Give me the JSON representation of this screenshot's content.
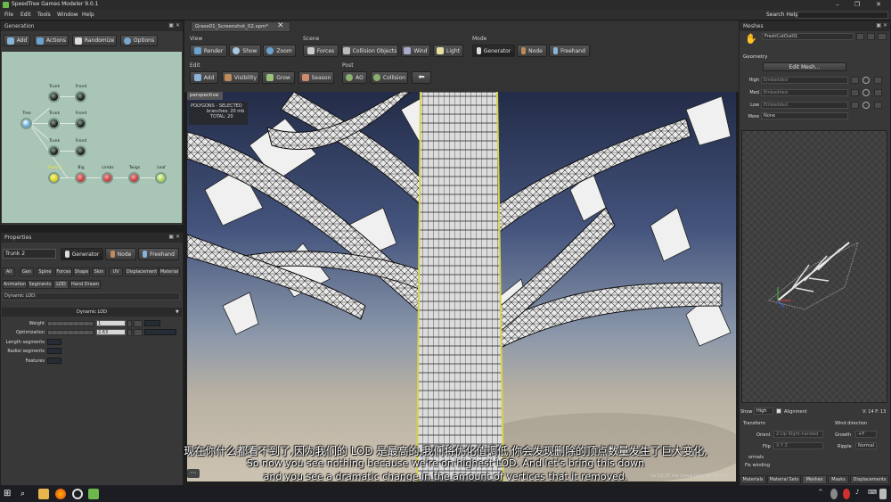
{
  "app": {
    "title": "SpeedTree Games Modeler 9.0.1"
  },
  "menu": [
    "File",
    "Edit",
    "Tools",
    "Window",
    "Help"
  ],
  "search_help": {
    "label": "Search Help:",
    "value": ""
  },
  "generation": {
    "title": "Generation",
    "toolbar": [
      "Add",
      "Actions",
      "Randomize",
      "Options"
    ],
    "nodes": {
      "root": "Tree",
      "trunk1": "Trunk",
      "frond1": "Frond",
      "trunk2": "Trunk",
      "frond2": "Frond",
      "trunk3": "Trunk",
      "frond3": "Frond",
      "trunk4": "Trunk 2",
      "big": "Big",
      "limbs": "Limbs",
      "twigs": "Twigs",
      "leaf": "Leaf"
    }
  },
  "properties": {
    "title": "Properties",
    "selected": "Trunk 2",
    "modes": [
      "Generator",
      "Node",
      "Freehand"
    ],
    "tabs_row1": [
      "All",
      "Gen",
      "Spine",
      "Forces",
      "Shape",
      "Skin",
      "UV",
      "Displacement",
      "Material"
    ],
    "tabs_row2": [
      "Animation",
      "Segments",
      "LOD",
      "Hand Drawn"
    ],
    "section": "Dynamic LOD:",
    "group": "Dynamic LOD",
    "rows": [
      {
        "label": "Weight",
        "value": "1"
      },
      {
        "label": "Optimization",
        "value": "2.63"
      },
      {
        "label": "Length segments",
        "value": ""
      },
      {
        "label": "Radial segments",
        "value": ""
      },
      {
        "label": "Features",
        "value": ""
      }
    ]
  },
  "document": {
    "tab": "Grass01_Screenshot_02.spm*"
  },
  "toolbar": {
    "view_label": "View",
    "view": [
      "Render",
      "Show",
      "Zoom"
    ],
    "scene_label": "Scene",
    "scene": [
      "Forces",
      "Collision Objects",
      "Wind",
      "Light"
    ],
    "mode_label": "Mode",
    "mode": [
      "Generator",
      "Node",
      "Freehand"
    ],
    "edit_label": "Edit",
    "edit": [
      "Add",
      "Visibility",
      "Grow",
      "Season"
    ],
    "post_label": "Post",
    "post": [
      "AO",
      "Collision"
    ]
  },
  "viewport": {
    "camera": "perspective",
    "polygons_header": "POLYGONS - SELECTED",
    "stat1_label": "branches:",
    "stat1_value": "20 mb",
    "stat2_label": "TOTAL:",
    "stat2_value": "20",
    "timing": "ite 10.35 ms (draw time 16.50 ms)"
  },
  "meshes": {
    "title": "Meshes",
    "mesh_name": "FreshCutOut01",
    "geometry": "Geometry",
    "edit_mesh": "Edit Mesh...",
    "lods": [
      {
        "label": "High",
        "value": "Embedded"
      },
      {
        "label": "Med",
        "value": "Embedded"
      },
      {
        "label": "Low",
        "value": "Embedded"
      }
    ],
    "more_label": "More",
    "more_value": "None",
    "show_label": "Show",
    "show_value": "High",
    "alignment": "Alignment",
    "counts": "V: 14 F: 13",
    "transform": "Transform",
    "orient_label": "Orient",
    "orient_value": "Z-Up Right-handed",
    "flip_label": "Flip",
    "flip_value": "X Y Z",
    "normals": "ormals",
    "fix_winding": "Fix winding",
    "wind_direction": "Wind direction",
    "growth_label": "Growth",
    "growth_value": "+Y",
    "ripple_label": "Ripple",
    "ripple_value": "Normal",
    "tabs": [
      "Materials",
      "Material Sets",
      "Meshes",
      "Masks",
      "Displacements"
    ]
  },
  "subtitles": {
    "zh": "现在你什么都看不到了,因为我们的 LOD 是最高的,我们将优化值调低,你会发现删除的顶点数量发生了巨大变化,",
    "en1": "So now you see nothing because we're on highest LOD. And let's bring this down",
    "en2": "and you see a dramatic change in the amount of vertices that it removed."
  },
  "colors": {
    "accent": "#6cb84d",
    "graph_bg": "#a9c5b6",
    "panel": "#383838"
  }
}
